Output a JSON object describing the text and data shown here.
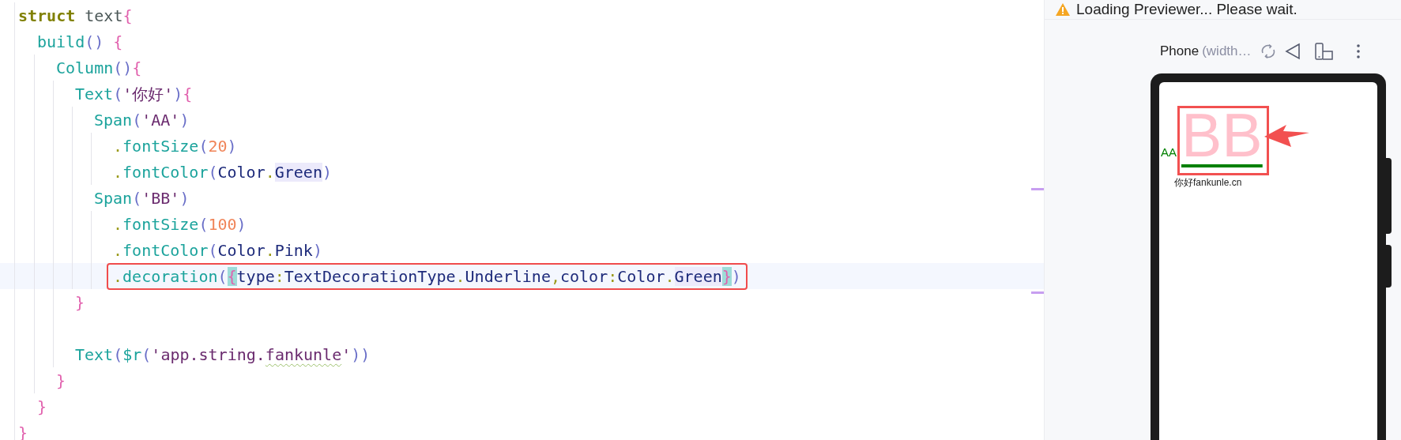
{
  "editor": {
    "lines": [
      {
        "kind": "code",
        "tokens": [
          {
            "text": "struct",
            "kind": "keyword"
          },
          {
            "text": " text",
            "kind": "plain"
          },
          {
            "text": "{",
            "kind": "brace"
          }
        ]
      },
      {
        "kind": "code",
        "tokens": [
          {
            "text": "  build",
            "kind": "func"
          },
          {
            "text": "()",
            "kind": "paren"
          },
          {
            "text": " {",
            "kind": "brace"
          }
        ]
      },
      {
        "kind": "code",
        "tokens": [
          {
            "text": "    Column",
            "kind": "func"
          },
          {
            "text": "()",
            "kind": "paren"
          },
          {
            "text": "{",
            "kind": "brace"
          }
        ]
      },
      {
        "kind": "code",
        "tokens": [
          {
            "text": "      Text",
            "kind": "func"
          },
          {
            "text": "(",
            "kind": "paren"
          },
          {
            "text": "'你好'",
            "kind": "string"
          },
          {
            "text": ")",
            "kind": "paren"
          },
          {
            "text": "{",
            "kind": "brace"
          }
        ]
      },
      {
        "kind": "code",
        "tokens": [
          {
            "text": "        Span",
            "kind": "func"
          },
          {
            "text": "(",
            "kind": "paren"
          },
          {
            "text": "'AA'",
            "kind": "string"
          },
          {
            "text": ")",
            "kind": "paren"
          }
        ]
      },
      {
        "kind": "code",
        "tokens": [
          {
            "text": "          .",
            "kind": "punct"
          },
          {
            "text": "fontSize",
            "kind": "func"
          },
          {
            "text": "(",
            "kind": "paren"
          },
          {
            "text": "20",
            "kind": "number"
          },
          {
            "text": ")",
            "kind": "paren"
          }
        ]
      },
      {
        "kind": "code",
        "tokens": [
          {
            "text": "          .",
            "kind": "punct"
          },
          {
            "text": "fontColor",
            "kind": "func"
          },
          {
            "text": "(",
            "kind": "paren"
          },
          {
            "text": "Color",
            "kind": "enum"
          },
          {
            "text": ".",
            "kind": "punct"
          },
          {
            "text": "Green",
            "kind": "enum",
            "usage_highlight": true
          },
          {
            "text": ")",
            "kind": "paren"
          }
        ]
      },
      {
        "kind": "code",
        "tokens": [
          {
            "text": "        Span",
            "kind": "func"
          },
          {
            "text": "(",
            "kind": "paren"
          },
          {
            "text": "'BB'",
            "kind": "string"
          },
          {
            "text": ")",
            "kind": "paren"
          }
        ]
      },
      {
        "kind": "code",
        "tokens": [
          {
            "text": "          .",
            "kind": "punct"
          },
          {
            "text": "fontSize",
            "kind": "func"
          },
          {
            "text": "(",
            "kind": "paren"
          },
          {
            "text": "100",
            "kind": "number"
          },
          {
            "text": ")",
            "kind": "paren"
          }
        ]
      },
      {
        "kind": "code",
        "tokens": [
          {
            "text": "          .",
            "kind": "punct"
          },
          {
            "text": "fontColor",
            "kind": "func"
          },
          {
            "text": "(",
            "kind": "paren"
          },
          {
            "text": "Color",
            "kind": "enum"
          },
          {
            "text": ".",
            "kind": "punct"
          },
          {
            "text": "Pink",
            "kind": "enum"
          },
          {
            "text": ")",
            "kind": "paren"
          }
        ]
      },
      {
        "kind": "code",
        "current": true,
        "boxed": true,
        "tokens": [
          {
            "text": "          .",
            "kind": "punct"
          },
          {
            "text": "decoration",
            "kind": "func"
          },
          {
            "text": "(",
            "kind": "paren"
          },
          {
            "text": "{",
            "kind": "brace",
            "brace_match": true
          },
          {
            "text": "type",
            "kind": "enum"
          },
          {
            "text": ":",
            "kind": "punct"
          },
          {
            "text": "TextDecorationType",
            "kind": "enum"
          },
          {
            "text": ".",
            "kind": "punct"
          },
          {
            "text": "Underline",
            "kind": "enum"
          },
          {
            "text": ",",
            "kind": "punct"
          },
          {
            "text": "color",
            "kind": "enum"
          },
          {
            "text": ":",
            "kind": "punct"
          },
          {
            "text": "Color",
            "kind": "enum"
          },
          {
            "text": ".",
            "kind": "punct"
          },
          {
            "text": "Green",
            "kind": "enum",
            "usage_highlight": true
          },
          {
            "text": "}",
            "kind": "brace",
            "brace_match": true
          },
          {
            "text": ")",
            "kind": "paren"
          }
        ]
      },
      {
        "kind": "code",
        "tokens": [
          {
            "text": "      }",
            "kind": "brace"
          }
        ]
      },
      {
        "kind": "blank"
      },
      {
        "kind": "code",
        "tokens": [
          {
            "text": "      Text",
            "kind": "func"
          },
          {
            "text": "(",
            "kind": "paren"
          },
          {
            "text": "$r",
            "kind": "func"
          },
          {
            "text": "(",
            "kind": "paren"
          },
          {
            "text": "'app.string.",
            "kind": "string"
          },
          {
            "text": "fankunle",
            "kind": "string",
            "squiggle": true
          },
          {
            "text": "'",
            "kind": "string"
          },
          {
            "text": "))",
            "kind": "paren"
          }
        ]
      },
      {
        "kind": "code",
        "tokens": [
          {
            "text": "    }",
            "kind": "brace"
          }
        ]
      },
      {
        "kind": "code",
        "tokens": [
          {
            "text": "  }",
            "kind": "brace"
          }
        ]
      },
      {
        "kind": "code",
        "tokens": [
          {
            "text": "}",
            "kind": "brace"
          }
        ]
      }
    ]
  },
  "previewer": {
    "status": "Loading Previewer... Please wait.",
    "device": "Phone",
    "device_detail": "(width…",
    "screen": {
      "spans": [
        {
          "text": "AA",
          "color": "#008000"
        },
        {
          "text": "BB",
          "color": "#ffc0cb",
          "underline": true
        }
      ],
      "second_text": "你好fankunle.cn"
    }
  }
}
